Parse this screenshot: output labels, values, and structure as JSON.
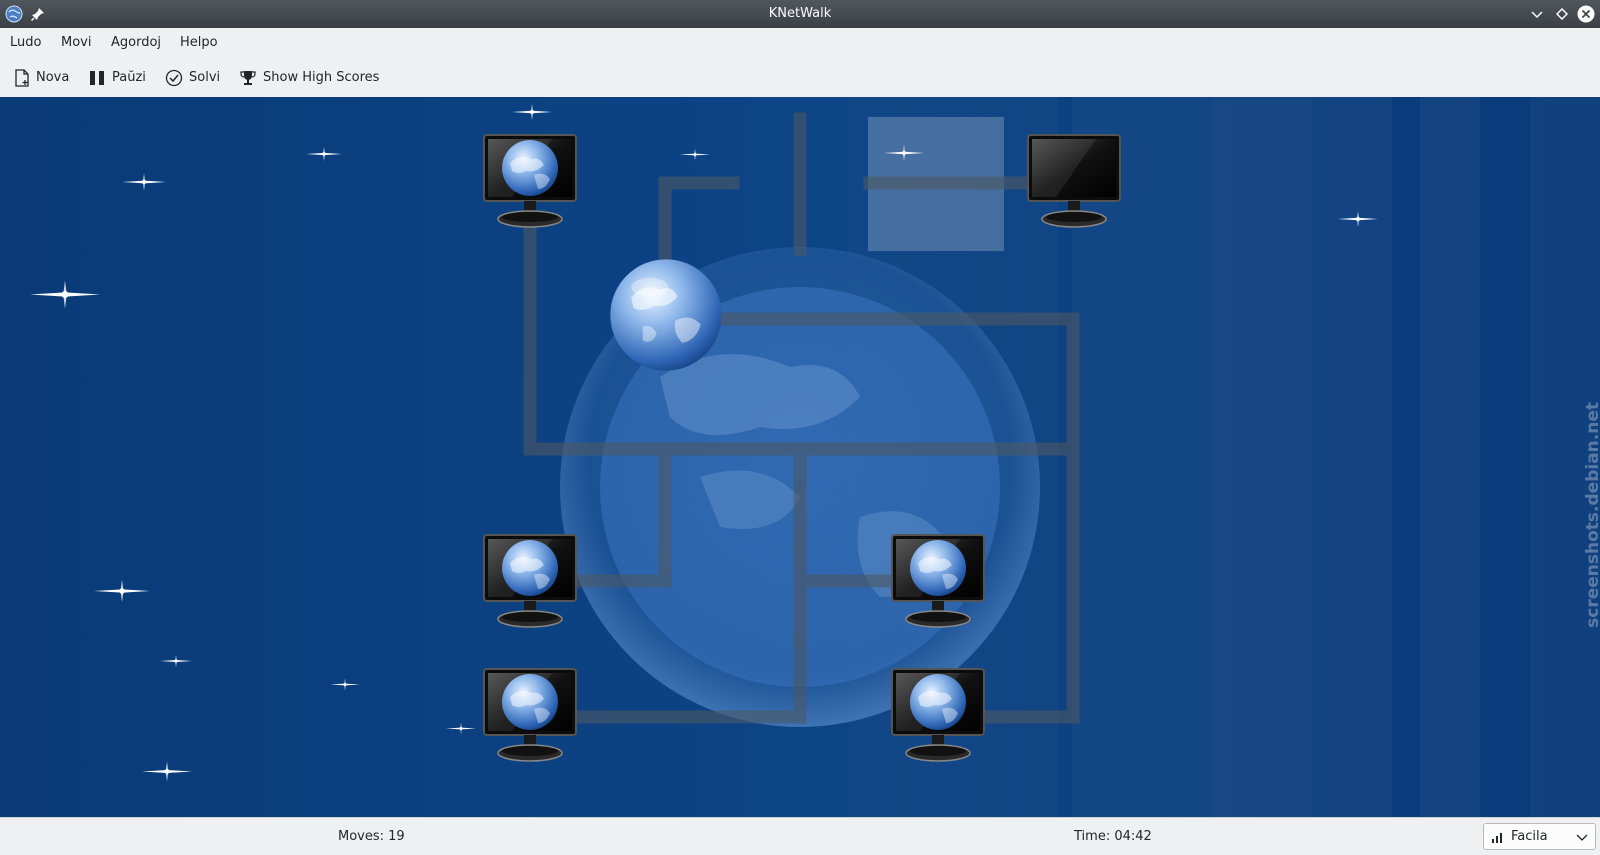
{
  "window": {
    "title": "KNetWalk",
    "app_icon": "knetwalk-globe-icon",
    "pin_icon": "pin-icon",
    "controls": [
      "minimize-icon",
      "maximize-icon",
      "close-icon"
    ]
  },
  "menubar": {
    "items": [
      {
        "label": "Ludo"
      },
      {
        "label": "Movi"
      },
      {
        "label": "Agordoj"
      },
      {
        "label": "Helpo"
      }
    ]
  },
  "toolbar": {
    "new_label": "Nova",
    "pause_label": "Paŭzi",
    "solve_label": "Solvi",
    "highscores_label": "Show High Scores"
  },
  "board": {
    "background_color": "#0b3d7e",
    "accent_color": "#6a9ad8",
    "watermark": "screenshots.debian.net",
    "server_icon": "globe-server-icon",
    "terminal_icon": "monitor-terminal-icon"
  },
  "status": {
    "moves": "Moves: 19",
    "time": "Time: 04:42",
    "difficulty": "Facila",
    "difficulty_icon": "signal-bars-icon"
  }
}
